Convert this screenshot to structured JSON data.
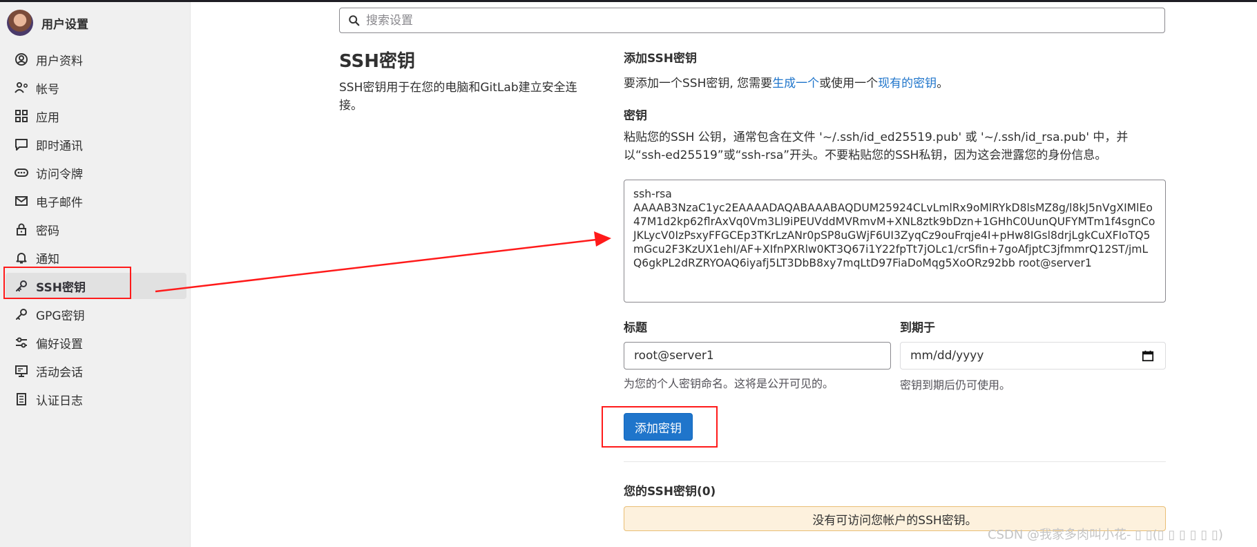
{
  "sidebar": {
    "title": "用户设置",
    "items": [
      {
        "label": "用户资料",
        "icon": "profile-icon"
      },
      {
        "label": "帐号",
        "icon": "account-icon"
      },
      {
        "label": "应用",
        "icon": "applications-icon"
      },
      {
        "label": "即时通讯",
        "icon": "chat-icon"
      },
      {
        "label": "访问令牌",
        "icon": "token-icon"
      },
      {
        "label": "电子邮件",
        "icon": "mail-icon"
      },
      {
        "label": "密码",
        "icon": "lock-icon"
      },
      {
        "label": "通知",
        "icon": "bell-icon"
      },
      {
        "label": "SSH密钥",
        "icon": "key-icon",
        "active": true
      },
      {
        "label": "GPG密钥",
        "icon": "gpg-key-icon"
      },
      {
        "label": "偏好设置",
        "icon": "preferences-icon"
      },
      {
        "label": "活动会话",
        "icon": "monitor-icon"
      },
      {
        "label": "认证日志",
        "icon": "log-icon"
      }
    ]
  },
  "search": {
    "placeholder": "搜索设置"
  },
  "section": {
    "title": "SSH密钥",
    "description": "SSH密钥用于在您的电脑和GitLab建立安全连接。"
  },
  "add_key": {
    "heading": "添加SSH密钥",
    "intro_prefix": "要添加一个SSH密钥, 您需要",
    "link_generate": "生成一个",
    "intro_middle": "或使用一个",
    "link_existing": "现有的密钥",
    "intro_suffix": "。",
    "key_label": "密钥",
    "key_help": "粘贴您的SSH 公钥，通常包含在文件 '~/.ssh/id_ed25519.pub' 或 '~/.ssh/id_rsa.pub' 中，并以“ssh-ed25519”或“ssh-rsa”开头。不要粘贴您的SSH私钥，因为这会泄露您的身份信息。",
    "key_value": "ssh-rsa\nAAAAB3NzaC1yc2EAAAADAQABAAABAQDUM25924CLvLmlRx9oMlRYkD8lsMZ8g/l8kJ5nVgXIMlEo47M1d2kp62flrAxVq0Vm3Ll9iPEUVddMVRmvM+XNL8ztk9bDzn+1GHhC0UunQUFYMTm1f4sgnCoJKLycV0IzPsxyFFGCEp3TKrLzANr0pSP8uGWjF6UI3ZyqCz9ouFrqje4I+pHw8IGsl8drjLgkCuXFIoTQ5mGcu2F3KzUX1ehI/AF+XIfnPXRlw0KT3Q67i1Y22fpTt7jOLc1/crSfin+7goAfjptC3jfmmrQ12ST/jmLQ6gkPL2dRZRYOAQ6iyafj5LT3DbB8xy7mqLtD97FiaDoMqg5XoORz92bb root@server1",
    "title_label": "标题",
    "title_value": "root@server1",
    "title_help": "为您的个人密钥命名。这将是公开可见的。",
    "expires_label": "到期于",
    "expires_placeholder": "mm/dd/yyyy",
    "expires_help": "密钥到期后仍可使用。",
    "submit_label": "添加密钥"
  },
  "your_keys": {
    "heading": "您的SSH密钥(0)",
    "empty_message": "没有可访问您帐户的SSH密钥。"
  },
  "watermark": "CSDN @我家多肉叫小花- ▯ ▯(▯ ▯ ▯ ▯ ▯ ▯)",
  "colors": {
    "primary": "#1f75cb",
    "annotation_red": "#ff1a1a",
    "alert_bg": "#fdf1dd",
    "sidebar_bg": "#f0f0f0"
  }
}
